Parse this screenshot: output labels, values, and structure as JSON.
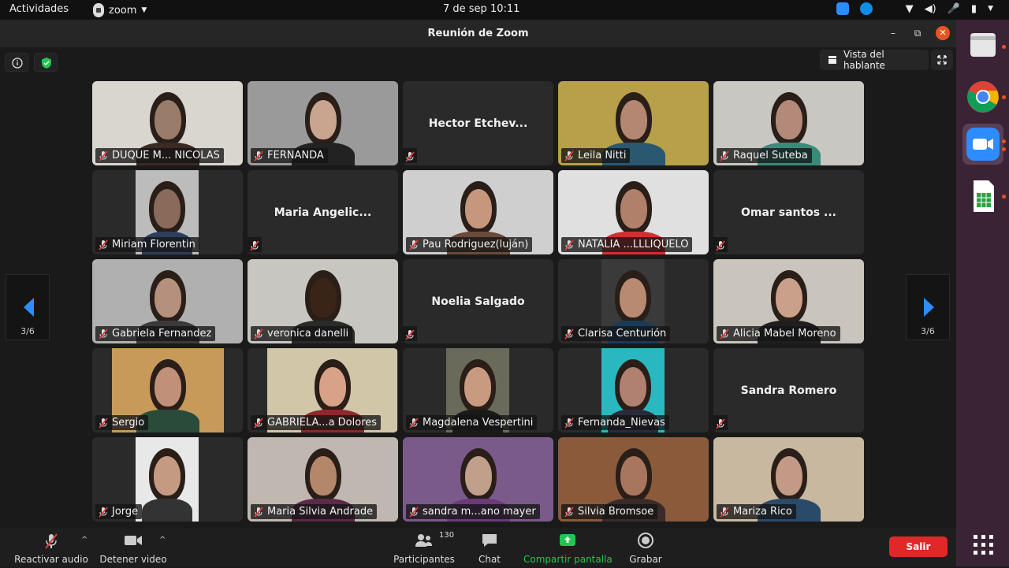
{
  "topbar": {
    "activities": "Actividades",
    "app_name": "zoom",
    "clock": "7 de sep  10:11"
  },
  "window": {
    "title": "Reunión de Zoom"
  },
  "view": {
    "speaker_view_label": "Vista del hablante",
    "page_indicator_left": "3/6",
    "page_indicator_right": "3/6"
  },
  "participants": [
    {
      "name": "DUQUE M... NICOLAS",
      "video": true
    },
    {
      "name": "FERNANDA",
      "video": true
    },
    {
      "name": "Hector Etchev...",
      "video": false
    },
    {
      "name": "Leila Nitti",
      "video": true
    },
    {
      "name": "Raquel Suteba",
      "video": true
    },
    {
      "name": "Miriam Florentin",
      "video": true
    },
    {
      "name": "Maria Angelic...",
      "video": false
    },
    {
      "name": "Pau Rodriguez(luján)",
      "video": true
    },
    {
      "name": "NATALIA ...LLLIQUELO",
      "video": true
    },
    {
      "name": "Omar santos ...",
      "video": false
    },
    {
      "name": "Gabriela Fernandez",
      "video": true
    },
    {
      "name": "veronica danelli",
      "video": true
    },
    {
      "name": "Noelia Salgado",
      "video": false
    },
    {
      "name": "Clarisa Centurión",
      "video": true
    },
    {
      "name": "Alicia Mabel Moreno",
      "video": true
    },
    {
      "name": "Sergio",
      "video": true
    },
    {
      "name": "GABRIELA...a Dolores",
      "video": true
    },
    {
      "name": "Magdalena Vespertini",
      "video": true
    },
    {
      "name": "Fernanda_Nievas",
      "video": true
    },
    {
      "name": "Sandra Romero",
      "video": false
    },
    {
      "name": "Jorge",
      "video": true
    },
    {
      "name": "Maria Silvia Andrade",
      "video": true
    },
    {
      "name": "sandra m...ano mayer",
      "video": true
    },
    {
      "name": "Silvia Bromsoe",
      "video": true
    },
    {
      "name": "Mariza Rico",
      "video": true
    }
  ],
  "toolbar": {
    "unmute": "Reactivar audio",
    "stop_video": "Detener video",
    "participants": "Participantes",
    "participant_count": "130",
    "chat": "Chat",
    "share": "Compartir pantalla",
    "record": "Grabar",
    "leave": "Salir"
  },
  "colors": {
    "accent_green": "#23c552",
    "leave_red": "#e02828",
    "arrow_blue": "#2d8cff",
    "muted_red": "#e03c3c"
  },
  "dock": {
    "items": [
      "files-icon",
      "chrome-icon",
      "zoom-icon",
      "spreadsheet-icon",
      "app-grid-icon"
    ]
  }
}
